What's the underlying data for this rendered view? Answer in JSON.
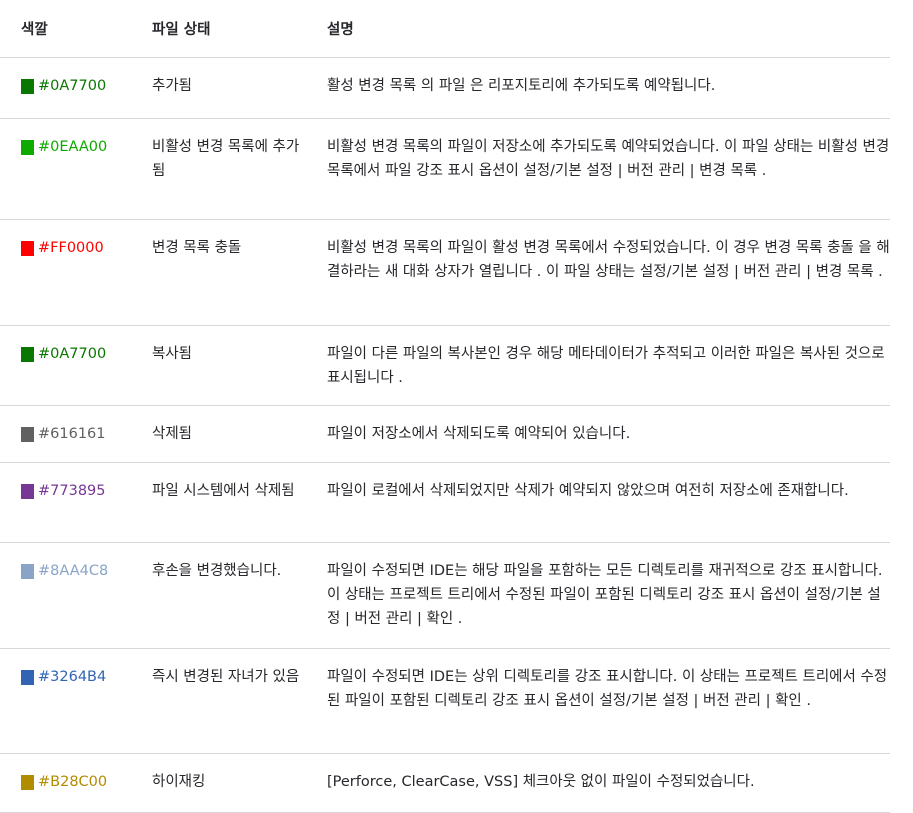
{
  "header": {
    "col_color": "색깔",
    "col_status": "파일 상태",
    "col_desc": "설명"
  },
  "rows": [
    {
      "hex": "#0A7700",
      "color": "#0A7700",
      "status": "추가됨",
      "desc": "활성 변경 목록 의 파일 은 리포지토리에 추가되도록 예약됩니다."
    },
    {
      "hex": "#0EAA00",
      "color": "#0EAA00",
      "status": "비활성 변경 목록에 추가됨",
      "desc": "비활성 변경 목록의 파일이 저장소에 추가되도록 예약되었습니다. 이 파일 상태는 비활성 변경 목록에서 파일 강조 표시 옵션이 설정/기본 설정 | 버전 관리 | 변경 목록 ."
    },
    {
      "hex": "#FF0000",
      "color": "#FF0000",
      "status": "변경 목록 충돌",
      "desc": "비활성 변경 목록의 파일이 활성 변경 목록에서 수정되었습니다. 이 경우 변경 목록 충돌 을 해결하라는 새 대화 상자가 열립니다 . 이 파일 상태는 설정/기본 설정 | 버전 관리 | 변경 목록 ."
    },
    {
      "hex": "#0A7700",
      "color": "#0A7700",
      "status": "복사됨",
      "desc": "파일이 다른 파일의 복사본인 경우 해당 메타데이터가 추적되고 이러한 파일은 복사된 것으로 표시됩니다 ."
    },
    {
      "hex": "#616161",
      "color": "#616161",
      "status": "삭제됨",
      "desc": "파일이 저장소에서 삭제되도록 예약되어 있습니다."
    },
    {
      "hex": "#773895",
      "color": "#773895",
      "status": "파일 시스템에서 삭제됨",
      "desc": "파일이 로컬에서 삭제되었지만 삭제가 예약되지 않았으며 여전히 저장소에 존재합니다."
    },
    {
      "hex": "#8AA4C8",
      "color": "#8AA4C8",
      "status": "후손을 변경했습니다.",
      "desc": "파일이 수정되면 IDE는 해당 파일을 포함하는 모든 디렉토리를 재귀적으로 강조 표시합니다. 이 상태는 프로젝트 트리에서 수정된 파일이 포함된 디렉토리 강조 표시 옵션이 설정/기본 설정 | 버전 관리 | 확인 ."
    },
    {
      "hex": "#3264B4",
      "color": "#3264B4",
      "status": "즉시 변경된 자녀가 있음",
      "desc": "파일이 수정되면 IDE는 상위 디렉토리를 강조 표시합니다. 이 상태는 프로젝트 트리에서 수정된 파일이 포함된 디렉토리 강조 표시 옵션이 설정/기본 설정 | 버전 관리 | 확인 ."
    },
    {
      "hex": "#B28C00",
      "color": "#B28C00",
      "status": "하이재킹",
      "desc": "[Perforce, ClearCase, VSS] 체크아웃 없이 파일이 수정되었습니다."
    }
  ]
}
